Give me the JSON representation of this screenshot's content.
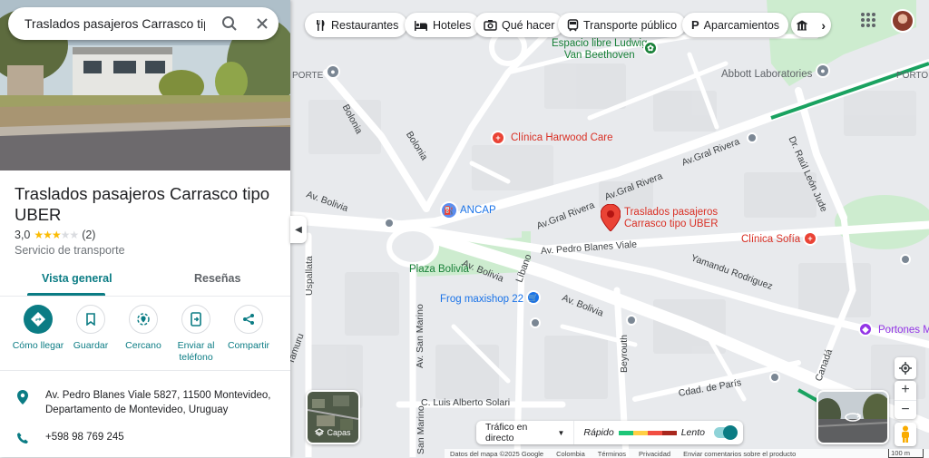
{
  "search": {
    "query": "Traslados pasajeros Carrasco tipo U"
  },
  "place": {
    "name": "Traslados pasajeros Carrasco tipo UBER",
    "rating": "3,0",
    "stars": 3,
    "review_count": "(2)",
    "category": "Servicio de transporte",
    "address": "Av. Pedro Blanes Viale 5827, 11500 Montevideo, Departamento de Montevideo, Uruguay",
    "phone": "+598 98 769 245"
  },
  "tabs": [
    {
      "label": "Vista general"
    },
    {
      "label": "Reseñas"
    }
  ],
  "actions": [
    {
      "label": "Cómo llegar",
      "icon": "directions-icon"
    },
    {
      "label": "Guardar",
      "icon": "bookmark-icon"
    },
    {
      "label": "Cercano",
      "icon": "nearby-icon"
    },
    {
      "label": "Enviar al teléfono",
      "icon": "send-to-phone-icon"
    },
    {
      "label": "Compartir",
      "icon": "share-icon"
    }
  ],
  "chips": [
    {
      "label": "Restaurantes",
      "icon": "restaurant-icon"
    },
    {
      "label": "Hoteles",
      "icon": "hotel-icon"
    },
    {
      "label": "Qué hacer",
      "icon": "camera-icon"
    },
    {
      "label": "Transporte público",
      "icon": "train-icon"
    },
    {
      "label": "Aparcamientos",
      "icon": "parking-icon"
    }
  ],
  "map": {
    "selected_place": "Traslados pasajeros\nCarrasco tipo UBER",
    "pois": {
      "espacio_libre": "Espacio libre Ludwig\nVan Beethoven",
      "abbott": "Abbott Laboratories",
      "harwood": "Clínica Harwood Care",
      "ancap": "ANCAP",
      "sofia": "Clínica Sofía",
      "plaza_bolivia": "Plaza Bolivia",
      "frog": "Frog maxishop 22",
      "portones": "Portones M",
      "porte": "PORTE",
      "porto": "PORTO"
    },
    "streets": {
      "bolonia_top": "Bolonia",
      "bolonia": "Bolonia",
      "gral_rivera_1": "Av.Gral Rivera",
      "gral_rivera_2": "Av.Gral Rivera",
      "gral_rivera_3": "Av.Gral Rivera",
      "raul_leon": "Dr. Raúl León Jude",
      "av_bolivia_left": "Av. Bolivia",
      "av_bolivia_mid": "Av. Bolivia",
      "av_bolivia_right": "Av. Bolivia",
      "pedro_blanes": "Av. Pedro Blanes Viale",
      "yamandu": "Yamandu Rodriguez",
      "libano": "Líbano",
      "uspallata": "Uspallata",
      "san_marino_1": "Av. San Marino",
      "san_marino_2": "San Marino",
      "beyrouth": "Beyrouth",
      "paris": "Cdad. de París",
      "solari": "C. Luis Alberto Solari",
      "canada": "Canadá",
      "mamuru": "Tamuru"
    },
    "colors": {
      "land": "#e8eaed",
      "road": "#ffffff",
      "park": "#cdeccf",
      "route": "#1aa260",
      "pin": "#ea4335"
    }
  },
  "traffic": {
    "mode": "Tráfico en directo",
    "fast": "Rápido",
    "slow": "Lento",
    "colors": [
      "#1ec678",
      "#ffcf44",
      "#f24e42",
      "#a9271e"
    ]
  },
  "layers": {
    "label": "Capas"
  },
  "attribution": {
    "items": [
      "Datos del mapa ©2025 Google",
      "Colombia",
      "Términos",
      "Privacidad",
      "Enviar comentarios sobre el producto"
    ],
    "scale": "100 m"
  }
}
